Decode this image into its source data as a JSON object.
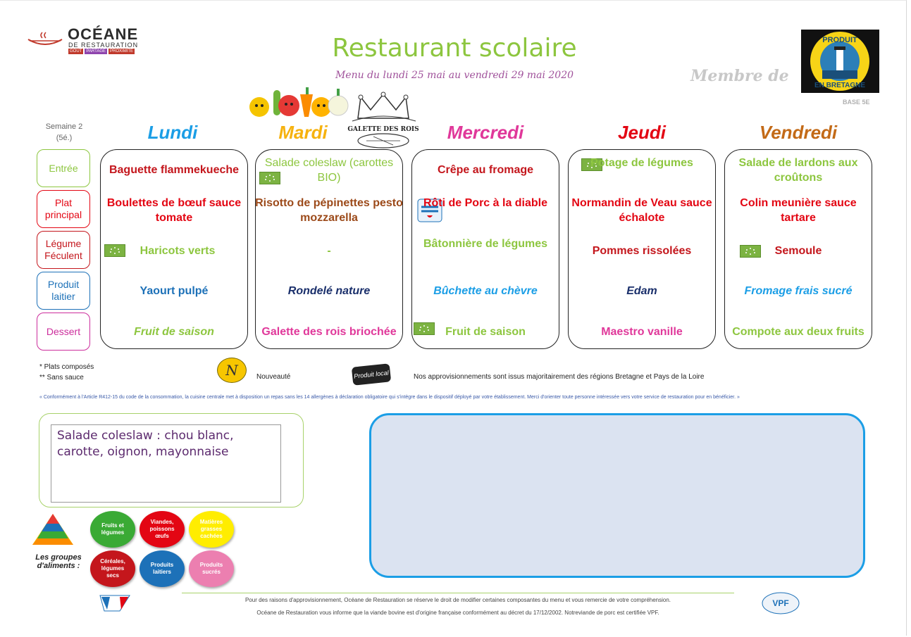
{
  "brand": {
    "name": "OCÉANE",
    "sub": "DE RESTAURATION",
    "tags": [
      "GOÛT",
      "PARTAGE",
      "PROXIMITÉ"
    ]
  },
  "title": "Restaurant scolaire",
  "subtitle": "Menu du lundi 25 mai au vendredi 29 mai 2020",
  "membre": "Membre de",
  "badge_lines": [
    "PRODUIT",
    "EN BRETAGNE"
  ],
  "base": "BASE 5E",
  "galette_crown": "GALETTE DES ROIS",
  "semaine": [
    "Semaine 2",
    "(5é.)"
  ],
  "rows": [
    "Entrée",
    "Plat principal",
    "Légume Féculent",
    "Produit laitier",
    "Dessert"
  ],
  "days": [
    {
      "name": "Lundi",
      "entree": "Baguette flammekueche",
      "plat": "Boulettes de bœuf sauce tomate",
      "legume": "Haricots verts",
      "laitier": "Yaourt pulpé",
      "dessert": "Fruit de saison"
    },
    {
      "name": "Mardi",
      "entree": "Salade coleslaw (carottes BIO)",
      "plat": "Risotto de pépinettes pesto mozzarella",
      "legume": "-",
      "laitier": "Rondelé nature",
      "dessert": "Galette des rois briochée"
    },
    {
      "name": "Mercredi",
      "entree": "Crêpe au fromage",
      "plat": "Rôti de Porc à la diable",
      "legume": "Bâtonnière de légumes",
      "laitier": "Bûchette au chèvre",
      "dessert": "Fruit de saison"
    },
    {
      "name": "Jeudi",
      "entree": "Potage de légumes",
      "plat": "Normandin de Veau sauce échalote",
      "legume": "Pommes rissolées",
      "laitier": "Edam",
      "dessert": "Maestro vanille"
    },
    {
      "name": "Vendredi",
      "entree": "Salade de lardons aux croûtons",
      "plat": "Colin meunière sauce tartare",
      "legume": "Semoule",
      "laitier": "Fromage frais sucré",
      "dessert": "Compote aux deux fruits"
    }
  ],
  "legend": {
    "composes": "* Plats composés",
    "sans_sauce": "** Sans sauce",
    "nouveaute_badge": "N",
    "nouveaute": "Nouveauté",
    "produit_local": "Produit local",
    "appro": "Nos  approvisionnements sont issus majoritairement des régions Bretagne et Pays de la Loire"
  },
  "conformite": "« Conformément à l'Article R412-15 du code de la consommation, la cuisine centrale met à disposition un repas sans les 14 allergènes à déclaration obligatoire qui s'intègre dans le dispositif déployé par votre établissement. Merci d'orienter toute personne intéressée vers votre service de restauration pour en bénéficier. »",
  "coleslaw_note": "Salade coleslaw : chou blanc, carotte, oignon, mayonnaise",
  "groups_label": "Les groupes d'aliments :",
  "food_groups": [
    {
      "label": "Fruits et légumes",
      "color": "#3aaa35"
    },
    {
      "label": "Viandes, poissons œufs",
      "color": "#e30613"
    },
    {
      "label": "Matières grasses cachées",
      "color": "#ffed00"
    },
    {
      "label": "Céréales, légumes secs",
      "color": "#c4161c"
    },
    {
      "label": "Produits laitiers",
      "color": "#1d71b8"
    },
    {
      "label": "Produits sucrés",
      "color": "#ec7fb0"
    }
  ],
  "footer": {
    "line1": "Pour des raisons d'approvisionnement, Océane de Restauration se réserve le droit de modifier certaines composantes du menu et vous remercie de votre compréhension.",
    "line2": "Océane de Restauration vous informe que la viande bovine est d'origine française conformément au décret du 17/12/2002. Notreviande de porc est certifiée VPF.",
    "vpf": "VPF"
  },
  "colors": {
    "title": "#8dc63f",
    "lundi": "#1b9ee6",
    "mardi": "#f6b20f",
    "mercredi": "#e0389a",
    "jeudi": "#e30613",
    "vendredi": "#c36a17",
    "entree_row": "#8dc63f",
    "plat_row": "#e30613",
    "legume_row": "#c4161c",
    "laitier_row": "#1d71b8",
    "dessert_row": "#cc2d9c"
  }
}
